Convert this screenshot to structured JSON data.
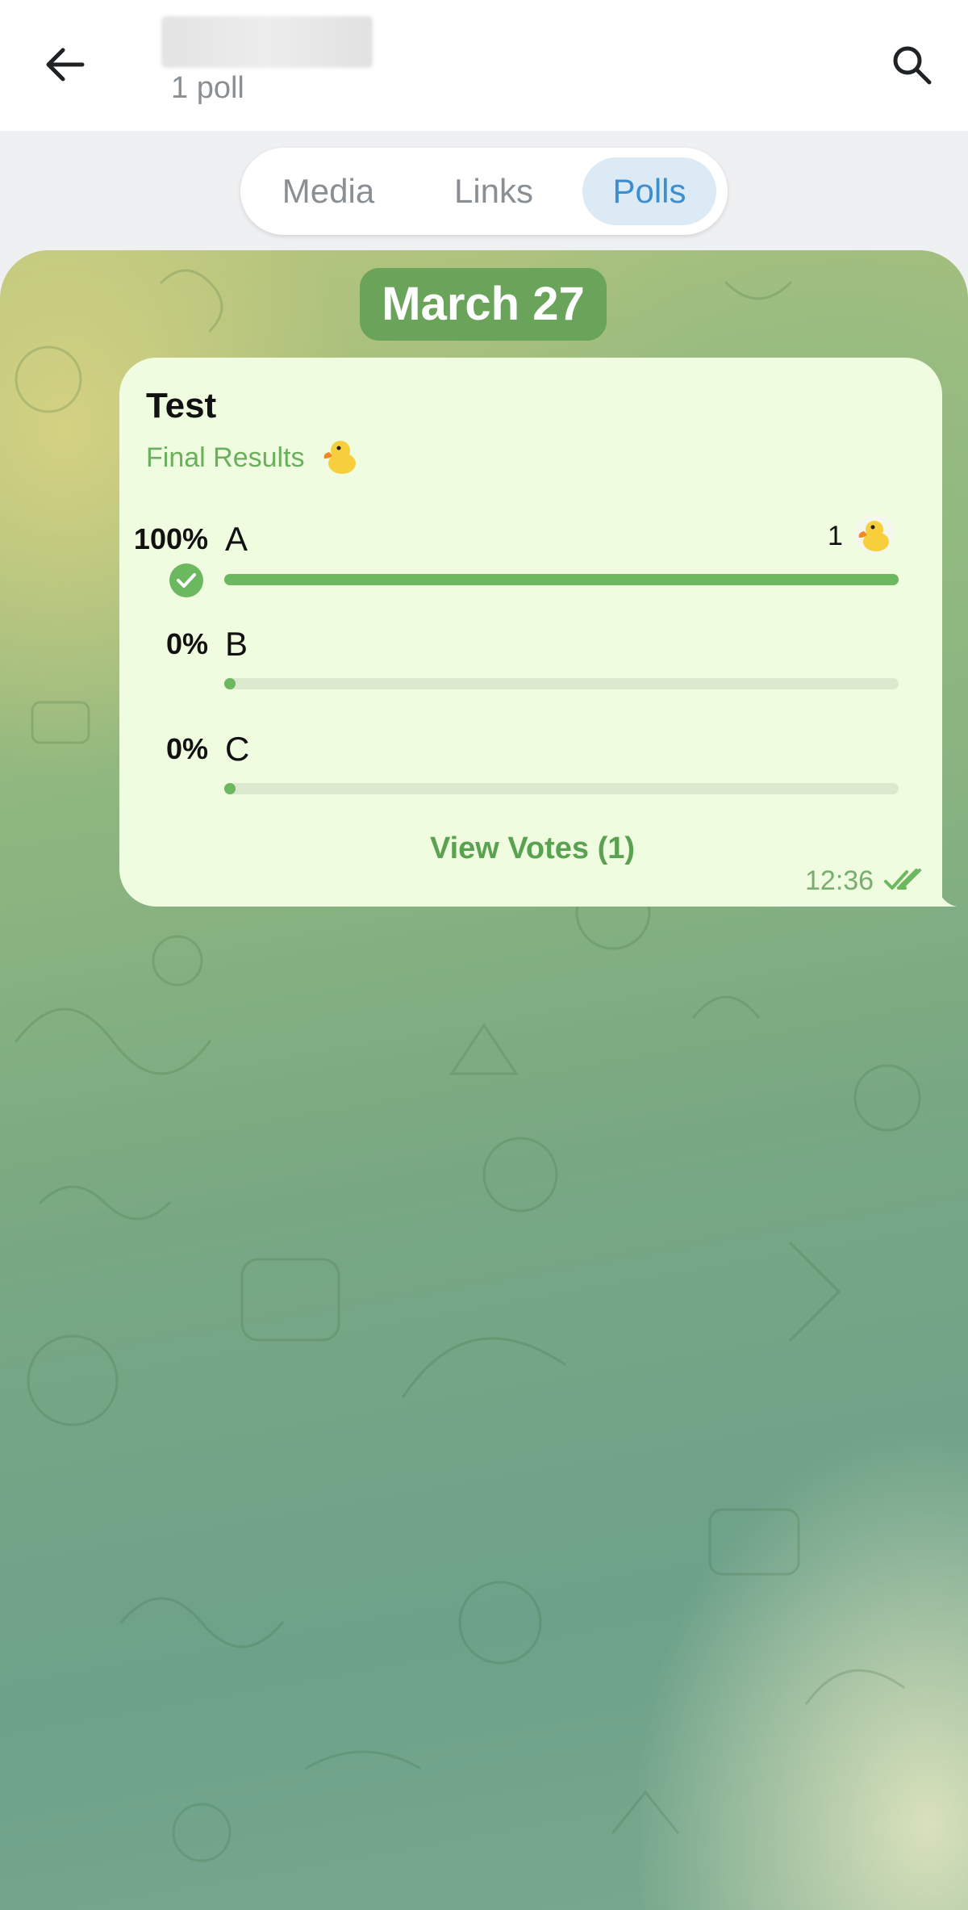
{
  "header": {
    "subtitle": "1 poll",
    "back_icon": "arrow-left-icon",
    "search_icon": "search-icon"
  },
  "tabs": [
    {
      "label": "Media",
      "active": false
    },
    {
      "label": "Links",
      "active": false
    },
    {
      "label": "Polls",
      "active": true
    }
  ],
  "date_chip": "March 27",
  "poll": {
    "question": "Test",
    "status": "Final Results",
    "options": [
      {
        "percent": "100%",
        "label": "A",
        "fraction": 1.0,
        "votes": "1",
        "chosen": true
      },
      {
        "percent": "0%",
        "label": "B",
        "fraction": 0.0
      },
      {
        "percent": "0%",
        "label": "C",
        "fraction": 0.0
      }
    ],
    "view_votes": "View Votes (1)",
    "time": "12:36",
    "read_status": "double-check-icon"
  },
  "colors": {
    "accent": "#3d8ecf",
    "bubble": "#effcdf",
    "poll_green": "#6bb85f",
    "date_chip": "#6aa35a"
  }
}
